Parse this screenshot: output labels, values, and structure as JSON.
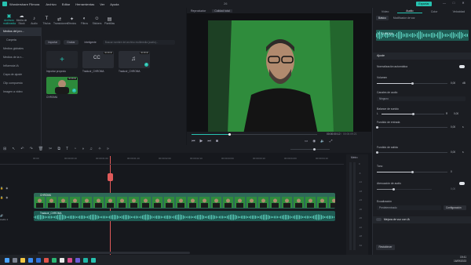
{
  "app": {
    "title": "Wondershare Filmora",
    "menu": [
      "Archivo",
      "Editar",
      "Herramientas",
      "Ver",
      "Ayuda"
    ],
    "project_name": "26",
    "export_label": "Exportar",
    "window_controls": [
      "—",
      "□",
      "✕"
    ],
    "accent": "#27c2b0"
  },
  "toolbar": {
    "tools": [
      {
        "label": "Archivos multimedia",
        "icon": "media-icon",
        "glyph": "▣",
        "active": true
      },
      {
        "label": "Media de Stock",
        "icon": "stock-icon",
        "glyph": "☁",
        "active": false
      },
      {
        "label": "Audio",
        "icon": "audio-icon",
        "glyph": "♪",
        "active": false
      },
      {
        "label": "Títulos",
        "icon": "title-icon",
        "glyph": "T",
        "active": false
      },
      {
        "label": "Transiciones",
        "icon": "transition-icon",
        "glyph": "⇄",
        "active": false
      },
      {
        "label": "Efectos",
        "icon": "effects-icon",
        "glyph": "✦",
        "active": false
      },
      {
        "label": "Filtros",
        "icon": "filter-icon",
        "glyph": "◐",
        "active": false
      },
      {
        "label": "Stickers",
        "icon": "sticker-icon",
        "glyph": "☺",
        "active": false
      },
      {
        "label": "Plantillas",
        "icon": "template-icon",
        "glyph": "▤",
        "active": false
      }
    ]
  },
  "media_sidebar": {
    "items": [
      "Medios del pro...",
      "Carpeta",
      "Medios globales",
      "Medios de la n...",
      "Influencia IA",
      "Capa de ajuste",
      "Clip compuesto",
      "Imagen a video"
    ],
    "selected": 0
  },
  "media_panel": {
    "import_label": "Importar",
    "record_label": "Grabar",
    "sort_label": "Inteligente",
    "search_placeholder": "Buscar nombre del archivo multimedia (audio)...",
    "items": [
      {
        "label": "Importar proyecto",
        "kind": "import"
      },
      {
        "label": "Traducir_CHROMA",
        "kind": "subtitle",
        "badge": "00:08:00"
      },
      {
        "label": "Traducir_CHROMA",
        "kind": "audio",
        "badge": "00:08:00"
      },
      {
        "label": "CHROMA",
        "kind": "video",
        "badge": "00:08:00"
      }
    ]
  },
  "preview": {
    "tabs": [
      "Reproductor",
      "Calidad total"
    ],
    "time_current": "00:00:00:12",
    "time_total": "00:00:09:21",
    "progress": 0.3
  },
  "right_panel": {
    "tabs": [
      "Vídeo",
      "Audio",
      "Color",
      "Velocidad"
    ],
    "selected_tab": 1,
    "subtabs": [
      "Básico",
      "Modificador de voz"
    ],
    "clip_name": "CHROMA",
    "section_title": "Ajuste",
    "auto_normalize_label": "Normalización automática",
    "volume": {
      "label": "Volumen",
      "value": "0,00",
      "unit": "dB",
      "level": 0.5
    },
    "channels": {
      "label": "Canales de audio",
      "value": "Ninguno"
    },
    "balance": {
      "label": "Balance de sonido",
      "left": "L",
      "right": "R",
      "value": "0,00",
      "level": 0.5
    },
    "fade_in": {
      "label": "Fundido de entrada",
      "value": "0,00",
      "unit": "s",
      "level": 0.0
    },
    "fade_out": {
      "label": "Fundido de salida",
      "value": "0,00",
      "unit": "s",
      "level": 0.0
    },
    "pitch": {
      "label": "Tono",
      "value": "0",
      "level": 0.5
    },
    "ducking": {
      "label": "Atenuación de audio",
      "value": "0,00",
      "level": 0.3
    },
    "equalizer": {
      "label": "Ecualización",
      "value": "Predeterminado",
      "config_label": "Configuración"
    },
    "voice_ai_label": "Mejora de voz con IA",
    "reset_label": "Restablecer"
  },
  "timeline": {
    "ruler_labels": [
      "00:00",
      "00:00:00:10",
      "00:00:01:00",
      "00:00:01:10",
      "00:00:02:00",
      "00:00:02:10",
      "00:00:03:00",
      "00:00:03:10",
      "00:00:04:00",
      "00:00:04:10"
    ],
    "tracks": [
      {
        "label": "Vídeo 2",
        "clip": ""
      },
      {
        "label": "Vídeo 1",
        "clip": "CHROMA"
      },
      {
        "label": "Audio 1",
        "clip": "Traducir_CHROMA"
      }
    ],
    "meter_label": "Metro",
    "meter_ticks": [
      "0",
      "-6",
      "-12",
      "-18",
      "-24",
      "-30",
      "-36",
      "-42",
      "-48",
      "-54"
    ],
    "zoom_level": 0.6
  },
  "taskbar": {
    "time": "19:41",
    "date": "16/09/2023"
  }
}
